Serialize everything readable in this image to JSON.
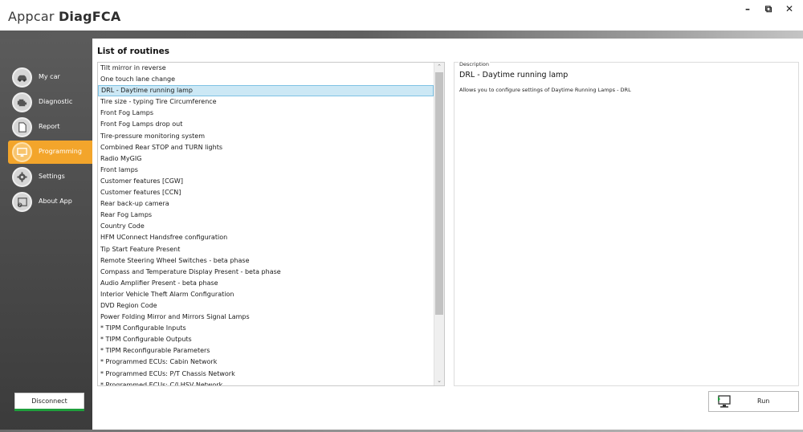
{
  "app": {
    "title_light": "Appcar ",
    "title_bold": "DiagFCA",
    "minimize": "–",
    "maximize": "⧉",
    "close": "✕"
  },
  "sidebar": {
    "items": [
      {
        "label": "My car",
        "icon": "car-icon",
        "active": false
      },
      {
        "label": "Diagnostic",
        "icon": "engine-icon",
        "active": false
      },
      {
        "label": "Report",
        "icon": "document-icon",
        "active": false
      },
      {
        "label": "Programming",
        "icon": "monitor-icon",
        "active": true
      },
      {
        "label": "Settings",
        "icon": "gear-icon",
        "active": false
      },
      {
        "label": "About App",
        "icon": "info-window-icon",
        "active": false
      }
    ],
    "disconnect_label": "Disconnect"
  },
  "main": {
    "list_title": "List of routines",
    "routines": [
      "Tilt mirror in reverse",
      "One touch lane change",
      "DRL - Daytime running lamp",
      "Tire size - typing Tire Circumference",
      "Front Fog Lamps",
      "Front Fog Lamps drop out",
      "Tire-pressure monitoring system",
      "Combined Rear STOP and TURN lights",
      "Radio MyGIG",
      "Front lamps",
      "Customer features [CGW]",
      "Customer features [CCN]",
      "Rear back-up camera",
      "Rear Fog Lamps",
      "Country Code",
      "HFM UConnect Handsfree configuration",
      "Tip Start Feature Present",
      "Remote Steering Wheel Switches - beta phase",
      "Compass and Temperature Display Present - beta phase",
      "Audio Amplifier Present - beta phase",
      "Interior Vehicle Theft Alarm Configuration",
      "DVD Region Code",
      "Power Folding Mirror and Mirrors Signal Lamps",
      "* TIPM Configurable Inputs",
      "* TIPM Configurable Outputs",
      "* TIPM Reconfigurable Parameters",
      "* Programmed ECUs: Cabin Network",
      "* Programmed ECUs: P/T Chassis Network",
      "* Programmed ECUs: C/I HSV Network"
    ],
    "selected_index": 2,
    "scroll_up": "⌃",
    "scroll_down": "⌄"
  },
  "description": {
    "caption": "Description",
    "title": "DRL - Daytime running lamp",
    "text": "Allows you to configure settings of Daytime Running Lamps - DRL"
  },
  "run": {
    "label": "Run",
    "icon": "monitor-run-icon"
  },
  "colors": {
    "accent": "#f3a52b",
    "selection": "#cce8f5",
    "connected": "#1f9f3c"
  }
}
